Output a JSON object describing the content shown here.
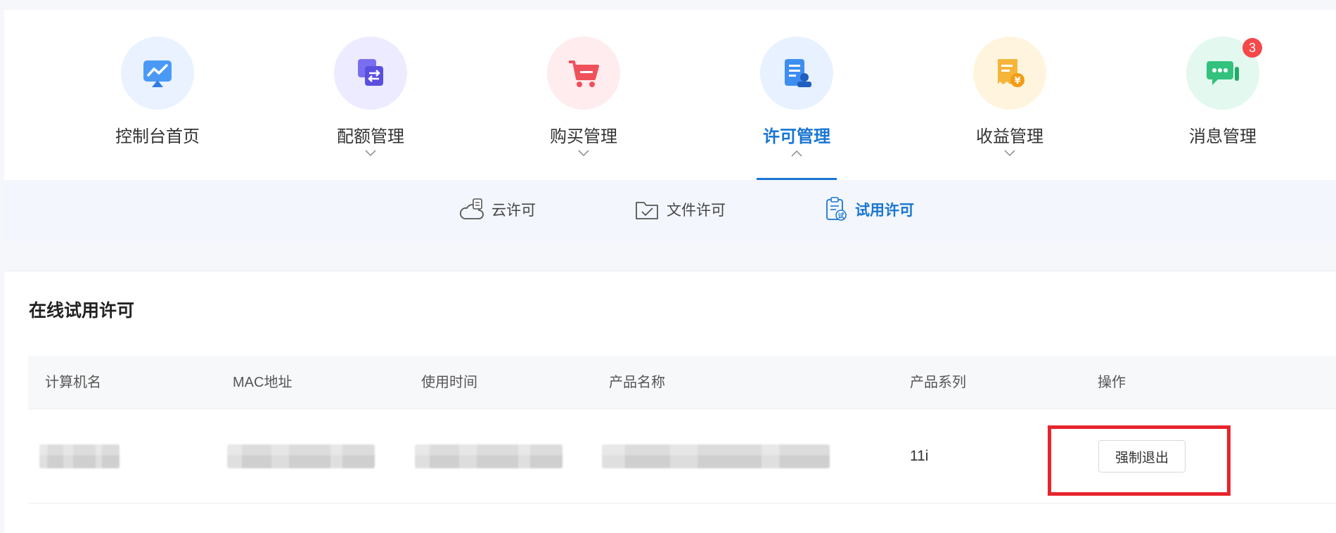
{
  "topnav": {
    "items": [
      {
        "label": "控制台首页",
        "icon": "dashboard-chart-icon",
        "has_dropdown": false,
        "active": false,
        "circle_color": "#eaf2ff"
      },
      {
        "label": "配额管理",
        "icon": "quota-swap-icon",
        "has_dropdown": true,
        "active": false,
        "circle_color": "#ecebff"
      },
      {
        "label": "购买管理",
        "icon": "shopping-cart-icon",
        "has_dropdown": true,
        "active": false,
        "circle_color": "#ffecee"
      },
      {
        "label": "许可管理",
        "icon": "license-doc-icon",
        "has_dropdown": true,
        "active": true,
        "circle_color": "#e8f1ff"
      },
      {
        "label": "收益管理",
        "icon": "revenue-receipt-icon",
        "has_dropdown": true,
        "active": false,
        "circle_color": "#fff5df"
      },
      {
        "label": "消息管理",
        "icon": "message-chat-icon",
        "has_dropdown": false,
        "active": false,
        "circle_color": "#e3f8ee",
        "badge": "3"
      }
    ]
  },
  "subnav": {
    "items": [
      {
        "label": "云许可",
        "icon": "cloud-license-icon",
        "active": false
      },
      {
        "label": "文件许可",
        "icon": "folder-check-icon",
        "active": false
      },
      {
        "label": "试用许可",
        "icon": "trial-clipboard-icon",
        "active": true
      }
    ]
  },
  "panel": {
    "title": "在线试用许可",
    "columns": [
      "计算机名",
      "MAC地址",
      "使用时间",
      "产品名称",
      "产品系列",
      "操作"
    ],
    "rows": [
      {
        "product_series": "11i",
        "action_label": "强制退出"
      }
    ]
  },
  "colors": {
    "accent": "#1976d2",
    "badge": "#f5484a",
    "highlight": "#e8242c"
  }
}
